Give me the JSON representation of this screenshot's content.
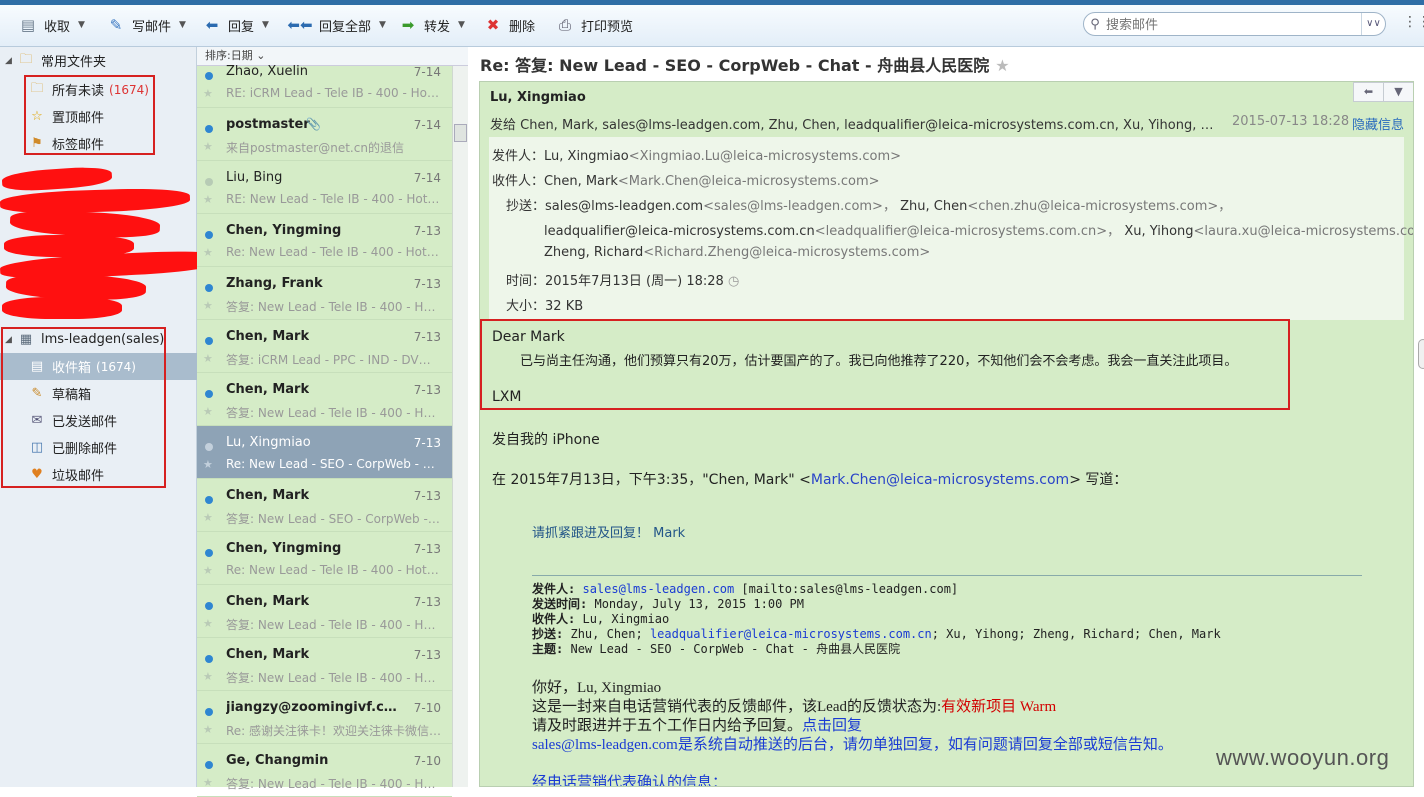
{
  "toolbar": {
    "receive": "收取",
    "compose": "写邮件",
    "reply": "回复",
    "reply_all": "回复全部",
    "forward": "转发",
    "delete": "删除",
    "print_preview": "打印预览",
    "search_placeholder": "搜索邮件"
  },
  "sidebar": {
    "common_folders": "常用文件夹",
    "all_unread": "所有未读",
    "all_unread_count": "(1674)",
    "pinned": "置顶邮件",
    "tagged": "标签邮件",
    "account": "lms-leadgen(sales)",
    "inbox": "收件箱",
    "inbox_count": "(1674)",
    "drafts": "草稿箱",
    "sent": "已发送邮件",
    "deleted": "已删除邮件",
    "junk": "垃圾邮件"
  },
  "list": {
    "sort_label": "排序:日期",
    "messages": [
      {
        "sender": "Zhao, Xuelin",
        "date": "7-14",
        "subject": "RE: iCRM Lead - Tele IB - 400 - Hot…"
      },
      {
        "sender": "postmaster",
        "date": "7-14",
        "subject": "来自postmaster@net.cn的退信"
      },
      {
        "sender": "Liu, Bing",
        "date": "7-14",
        "subject": "RE: New Lead - Tele IB - 400 - Hotl…"
      },
      {
        "sender": "Chen, Yingming",
        "date": "7-13",
        "subject": "Re: New Lead - Tele IB - 400 - Hotl…"
      },
      {
        "sender": "Zhang, Frank",
        "date": "7-13",
        "subject": "答复: New Lead - Tele IB - 400 - Ho…"
      },
      {
        "sender": "Chen, Mark",
        "date": "7-13",
        "subject": "答复: iCRM Lead - PPC - IND - DV…"
      },
      {
        "sender": "Chen, Mark",
        "date": "7-13",
        "subject": "答复: New Lead - Tele IB - 400 - Ho…"
      },
      {
        "sender": "Lu, Xingmiao",
        "date": "7-13",
        "subject": "Re: New Lead - SEO - CorpWeb - …"
      },
      {
        "sender": "Chen, Mark",
        "date": "7-13",
        "subject": "答复: New Lead - SEO - CorpWeb -…"
      },
      {
        "sender": "Chen, Yingming",
        "date": "7-13",
        "subject": "Re: New Lead - Tele IB - 400 - Hotl…"
      },
      {
        "sender": "Chen, Mark",
        "date": "7-13",
        "subject": "答复: New Lead - Tele IB - 400 - Ho…"
      },
      {
        "sender": "Chen, Mark",
        "date": "7-13",
        "subject": "答复: New Lead - Tele IB - 400 - Ho…"
      },
      {
        "sender": "jiangzy@zoomingivf.c…",
        "date": "7-10",
        "subject": "Re: 感谢关注徕卡！欢迎关注徕卡微信…"
      },
      {
        "sender": "Ge, Changmin",
        "date": "7-10",
        "subject": "答复: New Lead - Tele IB - 400 - Ho…"
      }
    ]
  },
  "mail": {
    "subject": "Re: 答复: New Lead - SEO - CorpWeb - Chat - 舟曲县人民医院",
    "from_name": "Lu, Xingmiao",
    "to_summary": "发给 Chen, Mark, sales@lms-leadgen.com, Zhu, Chen, leadqualifier@leica-microsystems.com.cn, Xu, Yihong, Zheng…",
    "datetime": "2015-07-13 18:28",
    "hide_info": "隐藏信息",
    "d_from_label": "发件人：",
    "d_from_name": "Lu, Xingmiao",
    "d_from_addr": "<Xingmiao.Lu@leica-microsystems.com>",
    "d_to_label": "收件人：",
    "d_to_name": "Chen, Mark",
    "d_to_addr": "<Mark.Chen@leica-microsystems.com>",
    "d_cc_label": "抄送：",
    "d_cc_line1_name1": "sales@lms-leadgen.com",
    "d_cc_line1_addr1": "<sales@lms-leadgen.com>，",
    "d_cc_line1_name2": "Zhu, Chen",
    "d_cc_line1_addr2": "<chen.zhu@leica-microsystems.com>，",
    "d_cc_line2_name1": "leadqualifier@leica-microsystems.com.cn",
    "d_cc_line2_addr1": "<leadqualifier@leica-microsystems.com.cn>，",
    "d_cc_line2_name2": "Xu, Yihong",
    "d_cc_line2_addr2": "<laura.xu@leica-microsystems.com>，",
    "d_cc_line3_name1": "Zheng, Richard",
    "d_cc_line3_addr1": "<Richard.Zheng@leica-microsystems.com>",
    "d_time_label": "时间：",
    "d_time": "2015年7月13日 (周一) 18:28",
    "d_size_label": "大小：",
    "d_size": "32 KB",
    "greeting": "Dear Mark",
    "body_line": "已与尚主任沟通，他们预算只有20万，估计要国产的了。我已向他推荐了220，不知他们会不会考虑。我会一直关注此项目。",
    "sign": "LXM",
    "sent_from": "发自我的 iPhone",
    "quote_intro_pre": "在 2015年7月13日，下午3:35，\"Chen, Mark\" <",
    "quote_intro_link": "Mark.Chen@leica-microsystems.com",
    "quote_intro_post": "> 写道：",
    "quoted_line": "请抓紧跟进及回复！ Mark",
    "fwd_from_label": "发件人:",
    "fwd_from_link": "sales@lms-leadgen.com",
    "fwd_from_mailto": "[mailto:sales@lms-leadgen.com]",
    "fwd_sent_label": "发送时间:",
    "fwd_sent": "Monday, July 13, 2015 1:00 PM",
    "fwd_to_label": "收件人:",
    "fwd_to": "Lu, Xingmiao",
    "fwd_cc_label": "抄送:",
    "fwd_cc_pre": "Zhu, Chen;",
    "fwd_cc_link": "leadqualifier@leica-microsystems.com.cn",
    "fwd_cc_post": "; Xu, Yihong; Zheng, Richard; Chen, Mark",
    "fwd_subj_label": "主题:",
    "fwd_subj": "New Lead - SEO - CorpWeb - Chat - 舟曲县人民医院",
    "hello": "你好，Lu, Xingmiao",
    "fb_pre": "这是一封来自电话营销代表的反馈邮件，该Lead的反馈状态为:",
    "fb_status": "有效新项目 Warm",
    "follow_pre": "请及时跟进并于五个工作日内给予回复。",
    "follow_link": "点击回复",
    "sys_line": "sales@lms-leadgen.com是系统自动推送的后台，请勿单独回复，如有问题请回复全部或短信告知。",
    "confirm_line": "经电话营销代表确认的信息："
  },
  "watermark": "www.wooyun.org"
}
